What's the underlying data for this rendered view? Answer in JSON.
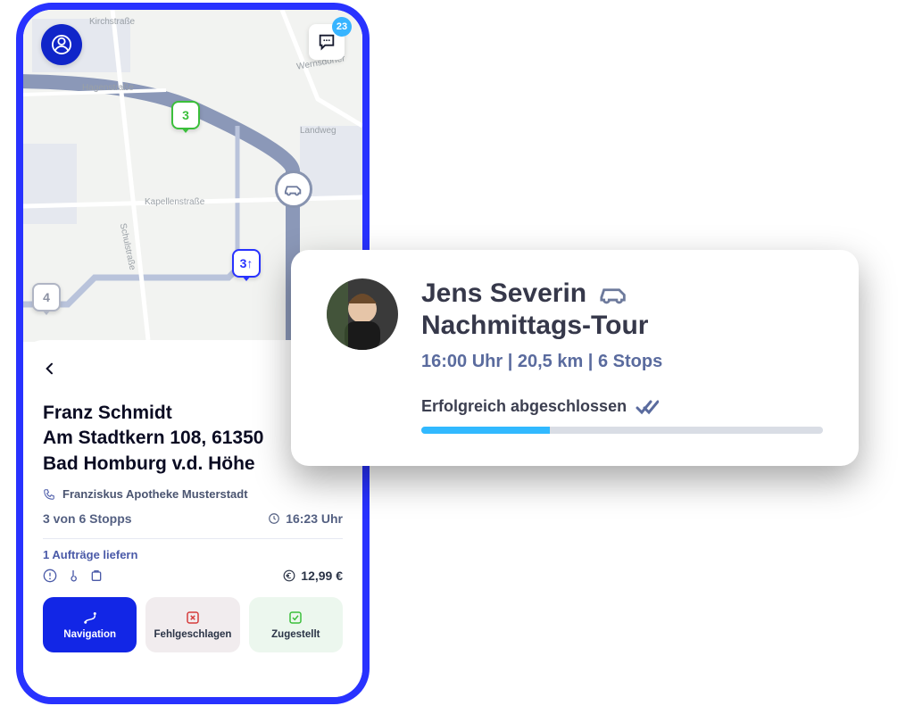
{
  "phone": {
    "chat_badge": "23",
    "markers": {
      "green": "3",
      "blue": "3↑",
      "gray": "4"
    },
    "streets": [
      "Kirchstraße",
      "Hagenstraße",
      "Landweg",
      "Kapellenstraße",
      "Schulstraße",
      "Wernsdorfer"
    ],
    "sheet": {
      "customer_name": "Franz Schmidt",
      "address_line1": "Am Stadtkern 108, 61350",
      "address_line2": "Bad Homburg v.d. Höhe",
      "pharmacy": "Franziskus Apotheke Musterstadt",
      "stops_progress": "3 von 6 Stopps",
      "time": "16:23 Uhr",
      "deliver_text": "1 Aufträge liefern",
      "price": "12,99 €",
      "nav_label": "Navigation",
      "fail_label": "Fehlgeschlagen",
      "done_label": "Zugestellt"
    }
  },
  "tour": {
    "driver": "Jens Severin",
    "name": "Nachmittags-Tour",
    "meta": "16:00 Uhr | 20,5 km | 6 Stops",
    "status": "Erfolgreich abgeschlossen",
    "progress_percent": 32
  }
}
